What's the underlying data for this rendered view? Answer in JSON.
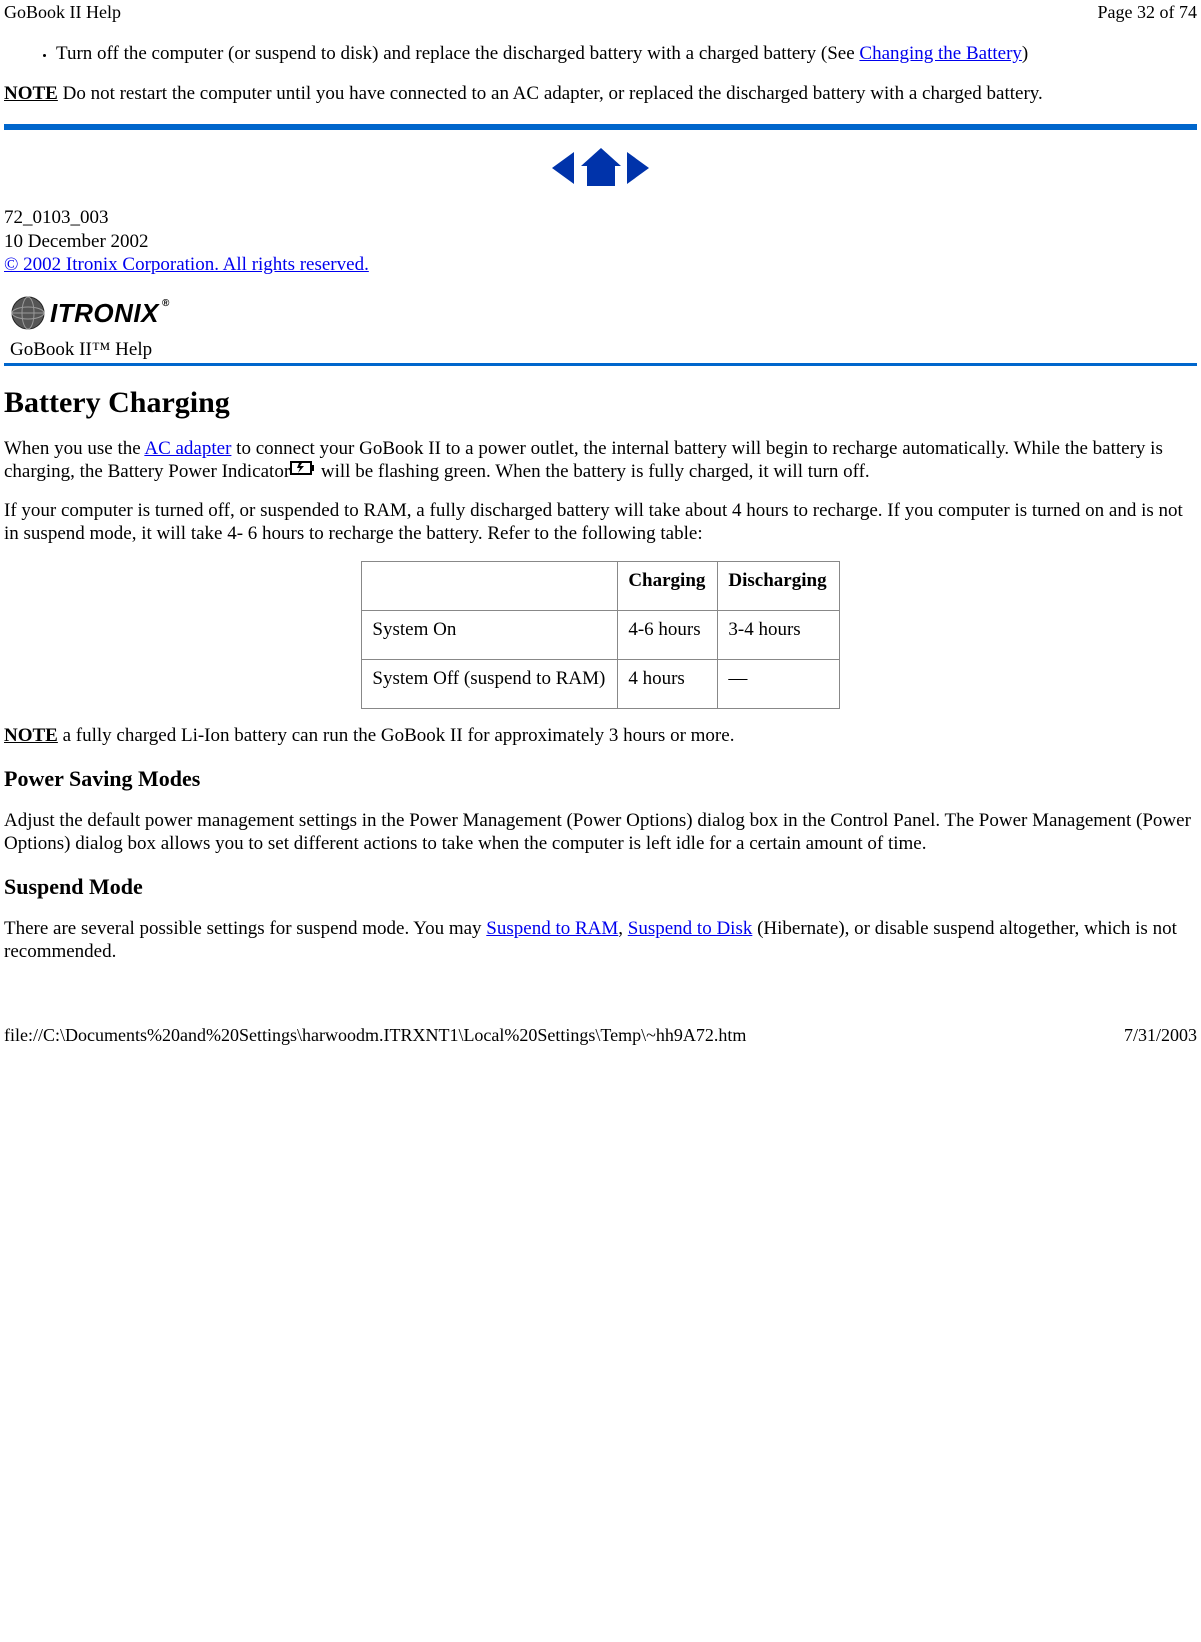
{
  "header": {
    "title": "GoBook II Help",
    "pageInfo": "Page 32 of 74"
  },
  "bulletItem": {
    "textPre": "Turn off the computer (or suspend to disk) and replace the discharged battery with a charged battery (See ",
    "link": "Changing the Battery",
    "textPost": ")"
  },
  "note1": {
    "label": "NOTE",
    "text": "  Do not restart the computer until you have connected to an AC adapter, or replaced the discharged battery with a charged battery."
  },
  "docMeta": {
    "docNum": "72_0103_003",
    "docDate": "10 December 2002",
    "copyright": "© 2002 Itronix Corporation.  All rights reserved."
  },
  "brand": {
    "name": "ITRONIX",
    "helpTitle": "GoBook II™ Help"
  },
  "section": {
    "h1": "Battery Charging",
    "para1": {
      "pre": "When you use the ",
      "link": "AC adapter",
      "mid": " to connect your GoBook II to a power outlet, the internal battery will begin to recharge automatically. While the battery is charging, the Battery Power Indicator",
      "post": "  will be flashing green. When the battery is fully charged, it will turn off."
    },
    "para2": "If your computer is turned off, or suspended to RAM, a fully discharged battery will take about 4 hours to recharge.  If you computer is turned on and is not in suspend mode, it will take 4- 6 hours to recharge the battery.  Refer to the following table:",
    "note2": {
      "label": "NOTE",
      "text": " a fully charged Li-Ion battery can run the GoBook II for approximately 3 hours or more."
    },
    "h2a": "Power Saving Modes",
    "para3": "Adjust the default power management settings in the Power Management (Power Options) dialog box in the Control Panel.  The Power Management (Power Options) dialog box allows you to set different actions to take when the computer is left idle for a certain amount of time.",
    "h2b": "Suspend Mode",
    "para4": {
      "pre": "There are several possible settings for suspend mode.  You may ",
      "link1": "Suspend to RAM",
      "mid": ", ",
      "link2": "Suspend to Disk",
      "post": " (Hibernate), or disable suspend altogether, which is not recommended."
    }
  },
  "table": {
    "headers": [
      "",
      "Charging",
      "Discharging"
    ],
    "rows": [
      [
        "System On",
        "4-6 hours",
        "3-4 hours"
      ],
      [
        "System Off (suspend to RAM)",
        "4 hours",
        "—"
      ]
    ]
  },
  "footer": {
    "path": "file://C:\\Documents%20and%20Settings\\harwoodm.ITRXNT1\\Local%20Settings\\Temp\\~hh9A72.htm",
    "date": "7/31/2003"
  }
}
